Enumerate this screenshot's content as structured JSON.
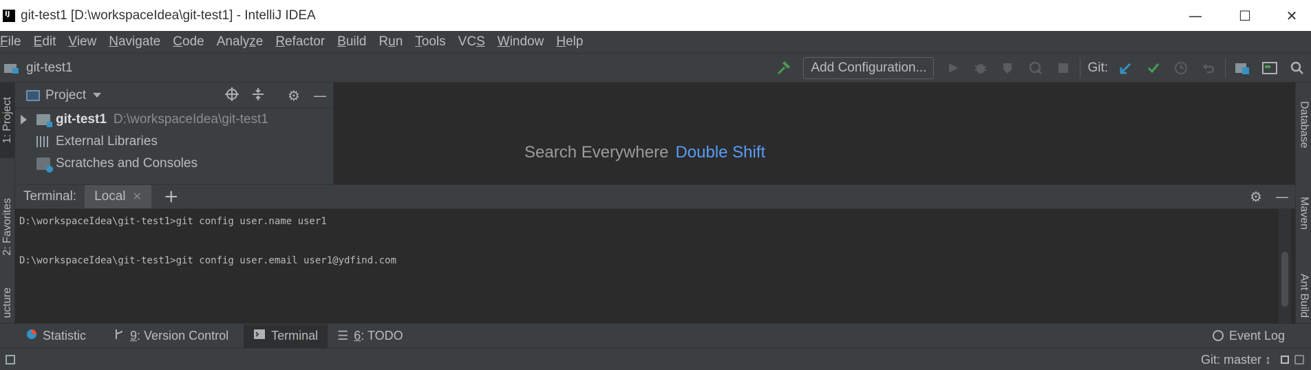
{
  "window": {
    "title": "git-test1 [D:\\workspaceIdea\\git-test1] - IntelliJ IDEA",
    "app_icon_text": "IJ"
  },
  "menu": [
    {
      "pre": "",
      "mn": "F",
      "post": "ile"
    },
    {
      "pre": "",
      "mn": "E",
      "post": "dit"
    },
    {
      "pre": "",
      "mn": "V",
      "post": "iew"
    },
    {
      "pre": "",
      "mn": "N",
      "post": "avigate"
    },
    {
      "pre": "",
      "mn": "C",
      "post": "ode"
    },
    {
      "pre": "Analy",
      "mn": "z",
      "post": "e"
    },
    {
      "pre": "",
      "mn": "R",
      "post": "efactor"
    },
    {
      "pre": "",
      "mn": "B",
      "post": "uild"
    },
    {
      "pre": "R",
      "mn": "u",
      "post": "n"
    },
    {
      "pre": "",
      "mn": "T",
      "post": "ools"
    },
    {
      "pre": "VC",
      "mn": "S",
      "post": ""
    },
    {
      "pre": "",
      "mn": "W",
      "post": "indow"
    },
    {
      "pre": "",
      "mn": "H",
      "post": "elp"
    }
  ],
  "navbar": {
    "project_name": "git-test1",
    "add_configuration": "Add Configuration...",
    "git_label": "Git:"
  },
  "project_panel": {
    "title": "Project",
    "tree": {
      "root_name": "git-test1",
      "root_path": "D:\\workspaceIdea\\git-test1",
      "external_libraries": "External Libraries",
      "scratches": "Scratches and Consoles"
    }
  },
  "editor": {
    "hint_text": "Search Everywhere",
    "hint_shortcut": "Double Shift"
  },
  "left_tabs": {
    "project": "1: Project",
    "favorites": "2: Favorites",
    "structure": "ucture"
  },
  "right_tabs": {
    "database": "Database",
    "maven": "Maven",
    "ant": "Ant Build"
  },
  "terminal": {
    "label": "Terminal:",
    "tab": "Local",
    "lines": [
      "D:\\workspaceIdea\\git-test1>git config user.name user1",
      "D:\\workspaceIdea\\git-test1>git config user.email user1@ydfind.com"
    ]
  },
  "bottom_tabs": {
    "statistic": "Statistic",
    "vc_num": "9",
    "vc_label": ": Version Control",
    "terminal": "Terminal",
    "todo_num": "6",
    "todo_label": ": TODO",
    "event_log": "Event Log"
  },
  "status": {
    "branch": "Git: master ↕"
  },
  "colors": {
    "accent_link": "#589df6",
    "build_hammer": "#499c54",
    "vcs_update": "#3592c4",
    "vcs_commit": "#499c54"
  }
}
